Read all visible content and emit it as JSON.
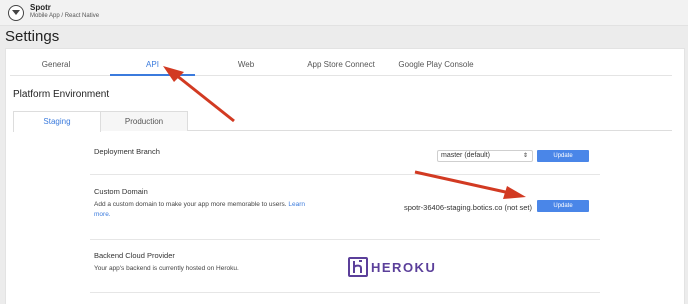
{
  "app": {
    "name": "Spotr",
    "subtitle": "Mobile App / React Native"
  },
  "page": {
    "title": "Settings"
  },
  "tabs": [
    {
      "label": "General"
    },
    {
      "label": "API"
    },
    {
      "label": "Web"
    },
    {
      "label": "App Store Connect"
    },
    {
      "label": "Google Play Console"
    }
  ],
  "active_tab": "API",
  "section": {
    "title": "Platform Environment"
  },
  "env_tabs": [
    {
      "label": "Staging"
    },
    {
      "label": "Production"
    }
  ],
  "active_env_tab": "Staging",
  "deployment": {
    "label": "Deployment Branch",
    "branch_value": "master (default)",
    "button": "Update"
  },
  "domain": {
    "label": "Custom Domain",
    "desc": "Add a custom domain to make your app more memorable to users.",
    "link": "Learn more.",
    "value": "spotr-36406-staging.botics.co (not set)",
    "button": "Update"
  },
  "backend": {
    "label": "Backend Cloud Provider",
    "desc": "Your app's backend is currently hosted on Heroku.",
    "logo_text": "HEROKU"
  },
  "colors": {
    "accent": "#3b7bdd",
    "button": "#4a86e8",
    "heroku": "#5b3f9a",
    "arrow": "#d23a22"
  },
  "icons": {
    "app_toggle": "chevron-down-circle-icon",
    "select_caret": "updown-caret-icon",
    "heroku": "heroku-logo-icon"
  }
}
